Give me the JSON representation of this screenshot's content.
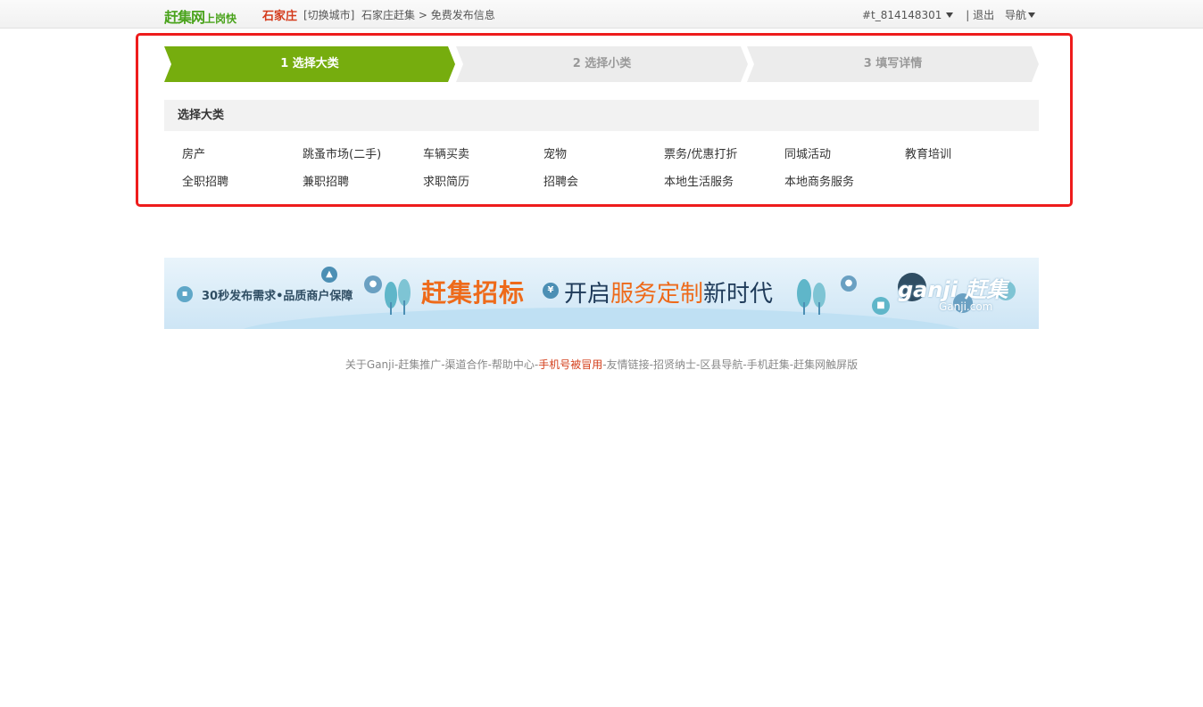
{
  "header": {
    "logo_main": "赶集网",
    "logo_sub": "上岗快",
    "city": "石家庄",
    "switch_city": "[切换城市]",
    "breadcrumb_home": "石家庄赶集",
    "breadcrumb_sep": " > ",
    "breadcrumb_current": "免费发布信息",
    "username": "#t_814148301",
    "divider": "|",
    "logout": "退出",
    "nav": "导航"
  },
  "steps": [
    {
      "label": "1 选择大类",
      "state": "active"
    },
    {
      "label": "2 选择小类",
      "state": "inactive"
    },
    {
      "label": "3 填写详情",
      "state": "inactive"
    }
  ],
  "category_section": {
    "title": "选择大类",
    "rows": [
      [
        "房产",
        "跳蚤市场(二手)",
        "车辆买卖",
        "宠物",
        "票务/优惠打折",
        "同城活动",
        "教育培训"
      ],
      [
        "全职招聘",
        "兼职招聘",
        "求职简历",
        "招聘会",
        "本地生活服务",
        "本地商务服务"
      ]
    ]
  },
  "banner": {
    "tagline": "30秒发布需求•品质商户保障",
    "brand": "赶集招标",
    "slogan_pre": "开启",
    "slogan_highlight": "服务定制",
    "slogan_post": "新时代",
    "logo_text": "ganji 赶集",
    "logo_domain": "Ganji.com",
    "icon_bubble": "¥"
  },
  "footer": {
    "links": [
      {
        "text": "关于Ganji",
        "highlight": false
      },
      {
        "text": "赶集推广",
        "highlight": false
      },
      {
        "text": "渠道合作",
        "highlight": false
      },
      {
        "text": "帮助中心",
        "highlight": false
      },
      {
        "text": "手机号被冒用",
        "highlight": true
      },
      {
        "text": "友情链接",
        "highlight": false
      },
      {
        "text": "招贤纳士",
        "highlight": false
      },
      {
        "text": "区县导航",
        "highlight": false
      },
      {
        "text": "手机赶集",
        "highlight": false
      },
      {
        "text": "赶集网触屏版",
        "highlight": false
      }
    ],
    "separator": "-"
  },
  "colors": {
    "brand_green": "#4aa31c",
    "step_active": "#76ad0e",
    "step_inactive": "#ececec",
    "highlight_border": "#ee1c1c",
    "accent_orange": "#ee6a1a"
  }
}
